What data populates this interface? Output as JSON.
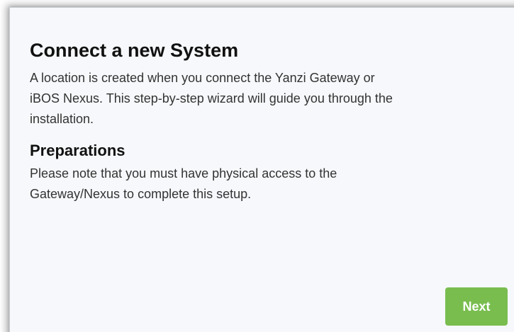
{
  "dialog": {
    "title": "Connect a new System",
    "intro_line_1": "A location is created when you connect the Yanzi Gateway or",
    "intro_line_2": "iBOS Nexus. This step-by-step wizard will guide you through the",
    "intro_line_3": "installation.",
    "preparations_title": "Preparations",
    "preparations_line_1": "Please note that you must have physical access to the",
    "preparations_line_2": "Gateway/Nexus to complete this setup.",
    "next_label": "Next"
  },
  "colors": {
    "background": "#f6f8fb",
    "next_button": "#79bd4f",
    "heading": "#111111",
    "body_text": "#333333"
  }
}
